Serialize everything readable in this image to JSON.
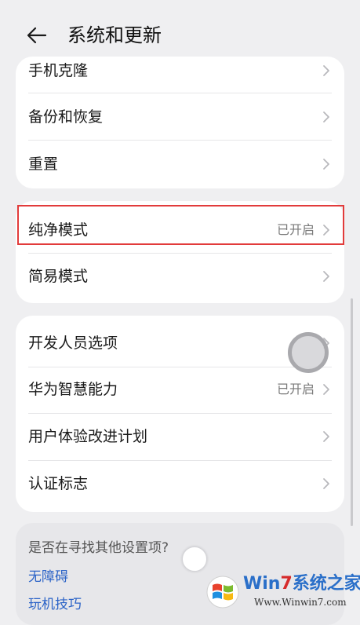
{
  "header": {
    "title": "系统和更新",
    "back_icon": "arrow-left-icon"
  },
  "group1": [
    {
      "label": "手机克隆"
    },
    {
      "label": "备份和恢复"
    },
    {
      "label": "重置"
    }
  ],
  "group2": [
    {
      "label": "纯净模式",
      "value": "已开启"
    },
    {
      "label": "简易模式"
    }
  ],
  "group3": [
    {
      "label": "开发人员选项"
    },
    {
      "label": "华为智慧能力",
      "value": "已开启"
    },
    {
      "label": "用户体验改进计划"
    },
    {
      "label": "认证标志"
    }
  ],
  "suggest": {
    "title": "是否在寻找其他设置项?",
    "links": [
      "无障碍",
      "玩机技巧"
    ]
  },
  "watermark": {
    "name_prefix": "Win",
    "name_highlight": "7",
    "name_suffix": "系统之家",
    "url": "Www.Winwin7.com"
  },
  "colors": {
    "highlight_border": "#e23b3b",
    "link": "#2b63c7",
    "background": "#efeff1",
    "card": "#ffffff"
  }
}
